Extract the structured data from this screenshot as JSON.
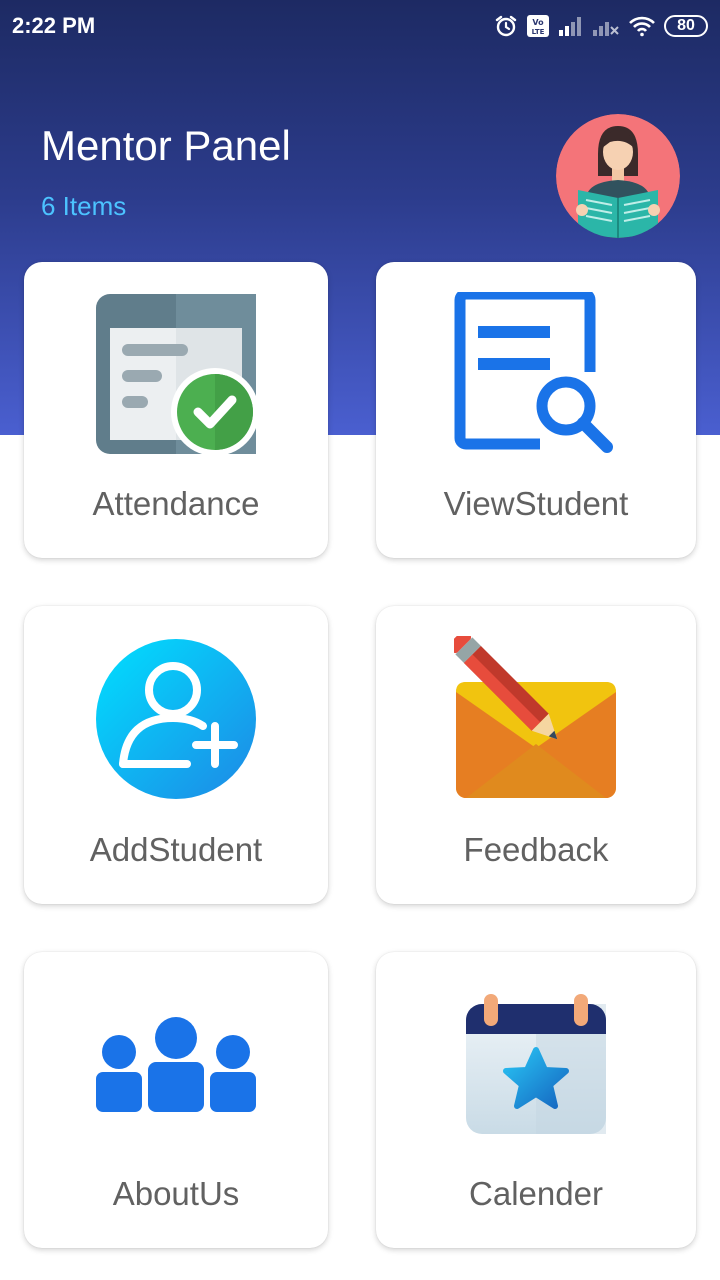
{
  "status_bar": {
    "time": "2:22 PM",
    "battery": "80",
    "icons": [
      "alarm-icon",
      "volte-icon",
      "signal-icon",
      "signal-no-service-icon",
      "wifi-icon",
      "battery-icon"
    ]
  },
  "header": {
    "title": "Mentor Panel",
    "subtitle": "6 Items",
    "avatar_icon": "mentor-reading-avatar"
  },
  "menu": {
    "items": [
      {
        "label": "Attendance",
        "icon": "attendance-icon"
      },
      {
        "label": "ViewStudent",
        "icon": "view-student-icon"
      },
      {
        "label": "AddStudent",
        "icon": "add-student-icon"
      },
      {
        "label": "Feedback",
        "icon": "feedback-icon"
      },
      {
        "label": "AboutUs",
        "icon": "about-us-icon"
      },
      {
        "label": "Calender",
        "icon": "calendar-icon"
      }
    ]
  },
  "colors": {
    "header_gradient_top": "#1d2a63",
    "header_gradient_bottom": "#4a5fd0",
    "subtitle": "#4cc3ff",
    "card_label": "#616161",
    "accent_blue": "#1a73e8"
  }
}
